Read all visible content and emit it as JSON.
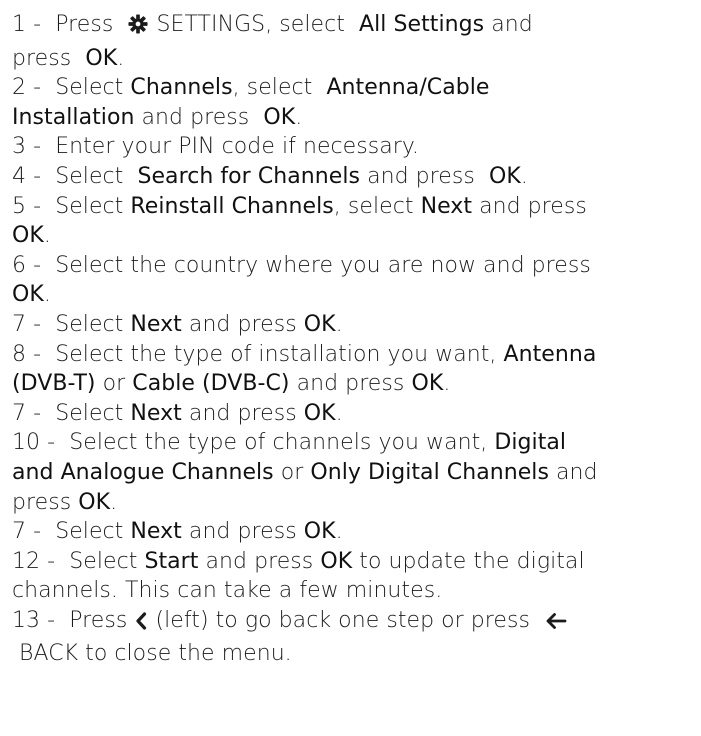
{
  "steps": {
    "s1": {
      "num": "1 -",
      "press": "Press",
      "icon_name": "settings-gear-icon",
      "settings": "SETTINGS, select",
      "all_settings": "All Settings",
      "and": "and",
      "press2": "press",
      "ok": "OK",
      "end": "."
    },
    "s2": {
      "num": "2 -",
      "select1": "Select",
      "channels": "Channels",
      "select2": ", select",
      "antenna_cable": "Antenna/Cable",
      "installation": "Installation",
      "and_press": "and press",
      "ok": "OK",
      "end": "."
    },
    "s3": {
      "num": "3 -",
      "text": "Enter your PIN code if necessary."
    },
    "s4": {
      "num": "4 -",
      "select": "Select",
      "search": "Search for Channels",
      "and_press": "and press",
      "ok": "OK",
      "end": "."
    },
    "s5": {
      "num": "5 -",
      "select": "Select",
      "reinstall": "Reinstall Channels",
      "select2": ", select",
      "next": "Next",
      "and_press": "and press",
      "ok": "OK",
      "end": "."
    },
    "s6": {
      "num": "6 -",
      "text": "Select the country where you are now and press",
      "ok": "OK",
      "end": "."
    },
    "s7a": {
      "num": "7 -",
      "select": "Select",
      "next": "Next",
      "and_press": "and press",
      "ok": "OK",
      "end": "."
    },
    "s8": {
      "num": "8 -",
      "text": "Select the type of installation you want,",
      "antenna": "Antenna",
      "antenna_dvb": "(DVB-T)",
      "or": "or",
      "cable": "Cable (DVB-C)",
      "and_press": "and press",
      "ok": "OK",
      "end": "."
    },
    "s7b": {
      "num": "7 -",
      "select": "Select",
      "next": "Next",
      "and_press": "and press",
      "ok": "OK",
      "end": "."
    },
    "s10": {
      "num": "10 -",
      "text": "Select the type of channels you want,",
      "digital": "Digital",
      "and_analogue": "and Analogue Channels",
      "or": "or",
      "only_digital": "Only Digital Channels",
      "and": "and",
      "press": "press",
      "ok": "OK",
      "end": "."
    },
    "s7c": {
      "num": "7 -",
      "select": "Select",
      "next": "Next",
      "and_press": "and press",
      "ok": "OK",
      "end": "."
    },
    "s12": {
      "num": "12 -",
      "select": "Select",
      "start": "Start",
      "and_press": "and press",
      "ok": "OK",
      "text": "to update the digital",
      "line2": "channels. This can take a few minutes."
    },
    "s13": {
      "num": "13 -",
      "press": "Press",
      "left_icon_name": "chevron-left-icon",
      "left_text": "(left) to go back one step or press",
      "back_icon_name": "back-arrow-icon",
      "back_text": "BACK to close the menu."
    }
  }
}
